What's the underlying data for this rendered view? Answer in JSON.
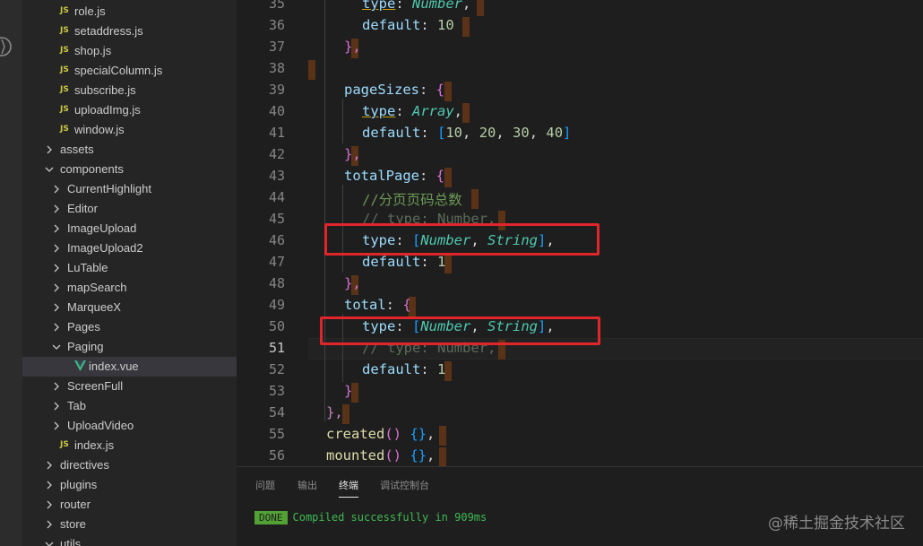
{
  "explorer": {
    "rows": [
      {
        "name": "role.js",
        "kind": "js"
      },
      {
        "name": "setaddress.js",
        "kind": "js"
      },
      {
        "name": "shop.js",
        "kind": "js"
      },
      {
        "name": "specialColumn.js",
        "kind": "js"
      },
      {
        "name": "subscribe.js",
        "kind": "js"
      },
      {
        "name": "uploadImg.js",
        "kind": "js"
      },
      {
        "name": "window.js",
        "kind": "js"
      },
      {
        "name": "assets",
        "kind": "folder-closed"
      },
      {
        "name": "components",
        "kind": "folder-open"
      },
      {
        "name": "CurrentHighlight",
        "kind": "folder-closed"
      },
      {
        "name": "Editor",
        "kind": "folder-closed"
      },
      {
        "name": "ImageUpload",
        "kind": "folder-closed"
      },
      {
        "name": "ImageUpload2",
        "kind": "folder-closed"
      },
      {
        "name": "LuTable",
        "kind": "folder-closed"
      },
      {
        "name": "mapSearch",
        "kind": "folder-closed"
      },
      {
        "name": "MarqueeX",
        "kind": "folder-closed"
      },
      {
        "name": "Pages",
        "kind": "folder-closed"
      },
      {
        "name": "Paging",
        "kind": "folder-open"
      },
      {
        "name": "index.vue",
        "kind": "vue"
      },
      {
        "name": "ScreenFull",
        "kind": "folder-closed"
      },
      {
        "name": "Tab",
        "kind": "folder-closed"
      },
      {
        "name": "UploadVideo",
        "kind": "folder-closed"
      },
      {
        "name": "index.js",
        "kind": "js"
      },
      {
        "name": "directives",
        "kind": "folder-closed"
      },
      {
        "name": "plugins",
        "kind": "folder-closed"
      },
      {
        "name": "router",
        "kind": "folder-closed"
      },
      {
        "name": "store",
        "kind": "folder-closed"
      },
      {
        "name": "utils",
        "kind": "folder-open"
      }
    ],
    "js_badge": "JS",
    "selected_file": "index.vue"
  },
  "editor": {
    "line_numbers": [
      "35",
      "36",
      "37",
      "38",
      "39",
      "40",
      "41",
      "42",
      "43",
      "44",
      "45",
      "46",
      "47",
      "48",
      "49",
      "50",
      "51",
      "52",
      "53",
      "54",
      "55",
      "56"
    ],
    "active_line": "51",
    "code": {
      "l35_key": "type",
      "l35_val": "Number",
      "l36_key": "default",
      "l36_val": "10",
      "l37": "},",
      "l39_key": "pageSizes",
      "l40_key": "type",
      "l40_val": "Array",
      "l41_key": "default",
      "l41_v1": "10",
      "l41_v2": "20",
      "l41_v3": "30",
      "l41_v4": "40",
      "l42": "},",
      "l43_key": "totalPage",
      "l44_comment": "//分页页码总数",
      "l45_comment": "// type: Number,",
      "l46_key": "type",
      "l46_v1": "Number",
      "l46_v2": "String",
      "l47_key": "default",
      "l47_val": "1",
      "l48": "},",
      "l49_key": "total",
      "l50_key": "type",
      "l50_v1": "Number",
      "l50_v2": "String",
      "l51_comment": "// type: Number,",
      "l52_key": "default",
      "l52_val": "1",
      "l53": "}",
      "l54": "},",
      "l55_fn": "created",
      "l56_fn": "mounted"
    }
  },
  "panel": {
    "tabs": [
      "问题",
      "输出",
      "终端",
      "调试控制台"
    ],
    "active_tab": "终端",
    "badge": "DONE",
    "message": "Compiled successfully in 909ms"
  },
  "watermark": "@稀土掘金技术社区",
  "colors": {
    "highlight_box": "#e0262b",
    "done_badge": "#52a135"
  }
}
